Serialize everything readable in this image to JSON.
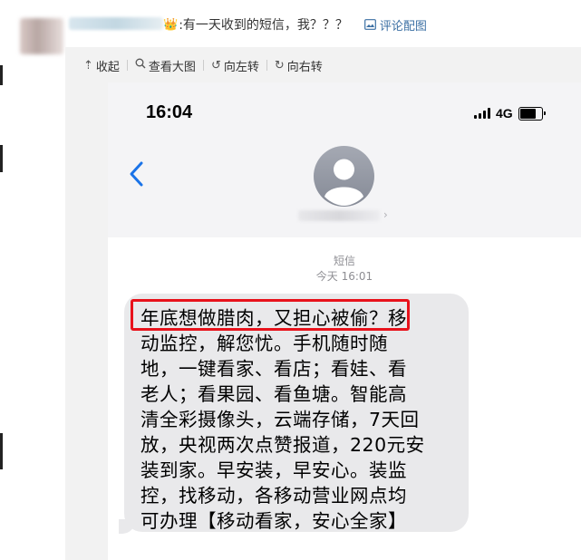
{
  "post": {
    "emoji": "👑",
    "text": ":有一天收到的短信，我？？？",
    "pic_link_label": "评论配图"
  },
  "toolbar": {
    "collapse": "收起",
    "view_large": "查看大图",
    "rotate_left": "向左转",
    "rotate_right": "向右转"
  },
  "phone": {
    "time": "16:04",
    "network": "4G",
    "sms_label": "短信",
    "sms_time": "今天 16:01"
  },
  "message": {
    "lines": [
      "年底想做腊肉，又担心被偷？移",
      "动监控，解您忧。手机随时随",
      "地，一键看家、看店；看娃、看",
      "老人；看果园、看鱼塘。智能高",
      "清全彩摄像头，云端存储，7天回",
      "放，央视两次点赞报道，220元安",
      "装到家。早安装，早安心。装监",
      "控，找移动，各移动营业网点均",
      "可办理【移动看家，安心全家】"
    ]
  },
  "colors": {
    "highlight": "#e8121b",
    "link": "#3b6fa3",
    "bubble": "#e9e9eb",
    "ios_blue": "#1a73e8"
  }
}
